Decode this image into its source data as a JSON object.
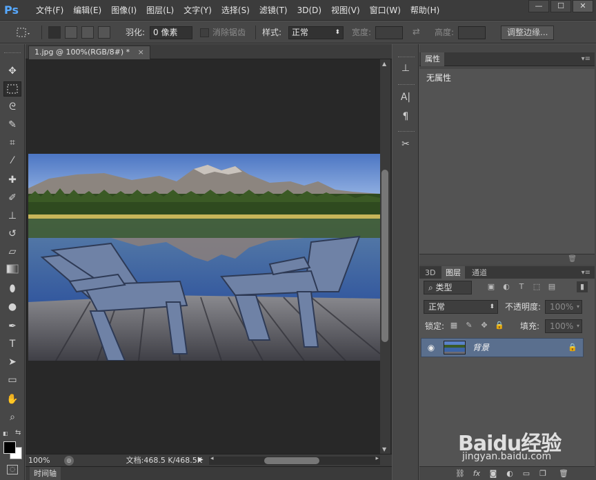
{
  "app": {
    "logo": "Ps",
    "menu": [
      "文件(F)",
      "编辑(E)",
      "图像(I)",
      "图层(L)",
      "文字(Y)",
      "选择(S)",
      "滤镜(T)",
      "3D(D)",
      "视图(V)",
      "窗口(W)",
      "帮助(H)"
    ],
    "window_buttons": [
      "—",
      "☐",
      "✕"
    ]
  },
  "options_bar": {
    "feather_label": "羽化:",
    "feather_value": "0 像素",
    "antialias_label": "消除锯齿",
    "style_label": "样式:",
    "style_value": "正常",
    "width_label": "宽度:",
    "height_label": "高度:",
    "refine_edge_button": "调整边缘..."
  },
  "document": {
    "tab_title": "1.jpg @ 100%(RGB/8#) *",
    "tab_close": "×",
    "zoom": "100%",
    "doc_info": "文档:468.5 K/468.5K",
    "timeline_label": "时间轴"
  },
  "properties_panel": {
    "tab": "属性",
    "empty_text": "无属性"
  },
  "layers_panel": {
    "tabs": [
      "3D",
      "图层",
      "通道"
    ],
    "active_tab": "图层",
    "filter_value": "类型",
    "blend_mode": "正常",
    "opacity_label": "不透明度:",
    "opacity_value": "100%",
    "lock_label": "锁定:",
    "fill_label": "填充:",
    "fill_value": "100%",
    "layers": [
      {
        "name": "背景",
        "visible": true,
        "locked": true
      }
    ]
  },
  "watermark": {
    "brand": "Baidu经验",
    "site": "jingyan.baidu.com"
  },
  "colors": {
    "accent_blue": "#57a9ff",
    "selected_layer": "#5a6f8e"
  }
}
